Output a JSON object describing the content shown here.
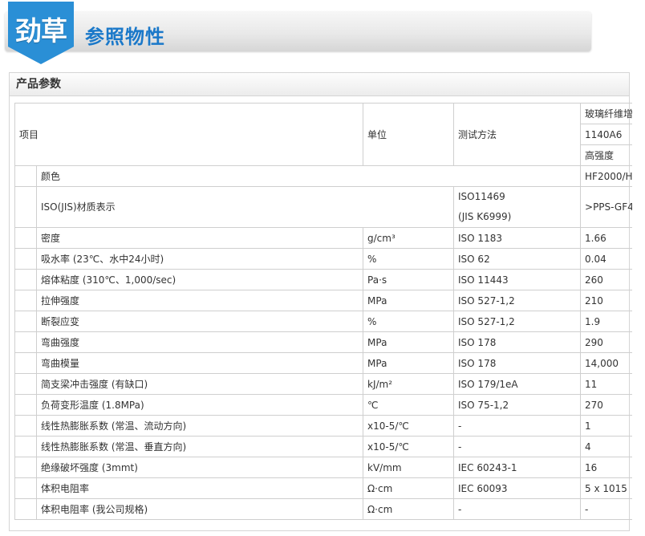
{
  "banner": {
    "logo_text": "劲草",
    "title": "参照物性"
  },
  "panel": {
    "title": "产品参数"
  },
  "table": {
    "header": {
      "item": "项目",
      "unit": "单位",
      "method": "测试方法",
      "grade_lines": [
        "玻璃纤维增",
        "1140A6",
        "高强度"
      ]
    },
    "color_row": {
      "label": "颜色",
      "value": "HF2000/H"
    },
    "iso_row": {
      "label": "ISO(JIS)材质表示",
      "method_lines": [
        "ISO11469",
        "(JIS K6999)"
      ],
      "value": ">PPS-GF4"
    },
    "rows": [
      {
        "label": "密度",
        "unit": "g/cm³",
        "method": "ISO 1183",
        "value": "1.66"
      },
      {
        "label": "吸水率 (23℃、水中24小时)",
        "unit": "%",
        "method": "ISO 62",
        "value": "0.04"
      },
      {
        "label": "熔体粘度 (310℃、1,000/sec)",
        "unit": "Pa·s",
        "method": "ISO 11443",
        "value": "260"
      },
      {
        "label": "拉伸强度",
        "unit": "MPa",
        "method": "ISO 527-1,2",
        "value": "210"
      },
      {
        "label": "断裂应变",
        "unit": "%",
        "method": "ISO 527-1,2",
        "value": "1.9"
      },
      {
        "label": "弯曲强度",
        "unit": "MPa",
        "method": "ISO 178",
        "value": "290"
      },
      {
        "label": "弯曲模量",
        "unit": "MPa",
        "method": "ISO 178",
        "value": "14,000"
      },
      {
        "label": "简支梁冲击强度 (有缺口)",
        "unit": "kJ/m²",
        "method": "ISO 179/1eA",
        "value": "11"
      },
      {
        "label": "负荷变形温度 (1.8MPa)",
        "unit": "℃",
        "method": "ISO 75-1,2",
        "value": "270"
      },
      {
        "label": "线性热膨胀系数 (常温、流动方向)",
        "unit": "x10-5/℃",
        "method": "-",
        "value": "1"
      },
      {
        "label": "线性热膨胀系数 (常温、垂直方向)",
        "unit": "x10-5/℃",
        "method": "-",
        "value": "4"
      },
      {
        "label": "绝缘破坏强度 (3mmt)",
        "unit": "kV/mm",
        "method": "IEC 60243-1",
        "value": "16"
      },
      {
        "label": "体积电阻率",
        "unit": "Ω·cm",
        "method": "IEC 60093",
        "value": "5 x 1015"
      },
      {
        "label": "体积电阻率 (我公司规格)",
        "unit": "Ω·cm",
        "method": "-",
        "value": "-"
      }
    ]
  },
  "colors": {
    "logo_blue": "#2a8fd6",
    "title_blue": "#1a78c9",
    "grid": "#cfcfcf"
  }
}
